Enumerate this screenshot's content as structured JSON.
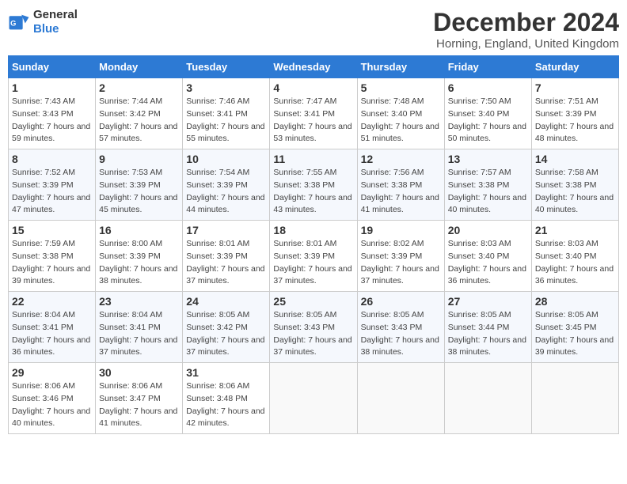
{
  "header": {
    "logo_line1": "General",
    "logo_line2": "Blue",
    "month": "December 2024",
    "location": "Horning, England, United Kingdom"
  },
  "weekdays": [
    "Sunday",
    "Monday",
    "Tuesday",
    "Wednesday",
    "Thursday",
    "Friday",
    "Saturday"
  ],
  "weeks": [
    [
      {
        "day": "1",
        "sunrise": "7:43 AM",
        "sunset": "3:43 PM",
        "daylight": "7 hours and 59 minutes."
      },
      {
        "day": "2",
        "sunrise": "7:44 AM",
        "sunset": "3:42 PM",
        "daylight": "7 hours and 57 minutes."
      },
      {
        "day": "3",
        "sunrise": "7:46 AM",
        "sunset": "3:41 PM",
        "daylight": "7 hours and 55 minutes."
      },
      {
        "day": "4",
        "sunrise": "7:47 AM",
        "sunset": "3:41 PM",
        "daylight": "7 hours and 53 minutes."
      },
      {
        "day": "5",
        "sunrise": "7:48 AM",
        "sunset": "3:40 PM",
        "daylight": "7 hours and 51 minutes."
      },
      {
        "day": "6",
        "sunrise": "7:50 AM",
        "sunset": "3:40 PM",
        "daylight": "7 hours and 50 minutes."
      },
      {
        "day": "7",
        "sunrise": "7:51 AM",
        "sunset": "3:39 PM",
        "daylight": "7 hours and 48 minutes."
      }
    ],
    [
      {
        "day": "8",
        "sunrise": "7:52 AM",
        "sunset": "3:39 PM",
        "daylight": "7 hours and 47 minutes."
      },
      {
        "day": "9",
        "sunrise": "7:53 AM",
        "sunset": "3:39 PM",
        "daylight": "7 hours and 45 minutes."
      },
      {
        "day": "10",
        "sunrise": "7:54 AM",
        "sunset": "3:39 PM",
        "daylight": "7 hours and 44 minutes."
      },
      {
        "day": "11",
        "sunrise": "7:55 AM",
        "sunset": "3:38 PM",
        "daylight": "7 hours and 43 minutes."
      },
      {
        "day": "12",
        "sunrise": "7:56 AM",
        "sunset": "3:38 PM",
        "daylight": "7 hours and 41 minutes."
      },
      {
        "day": "13",
        "sunrise": "7:57 AM",
        "sunset": "3:38 PM",
        "daylight": "7 hours and 40 minutes."
      },
      {
        "day": "14",
        "sunrise": "7:58 AM",
        "sunset": "3:38 PM",
        "daylight": "7 hours and 40 minutes."
      }
    ],
    [
      {
        "day": "15",
        "sunrise": "7:59 AM",
        "sunset": "3:38 PM",
        "daylight": "7 hours and 39 minutes."
      },
      {
        "day": "16",
        "sunrise": "8:00 AM",
        "sunset": "3:39 PM",
        "daylight": "7 hours and 38 minutes."
      },
      {
        "day": "17",
        "sunrise": "8:01 AM",
        "sunset": "3:39 PM",
        "daylight": "7 hours and 37 minutes."
      },
      {
        "day": "18",
        "sunrise": "8:01 AM",
        "sunset": "3:39 PM",
        "daylight": "7 hours and 37 minutes."
      },
      {
        "day": "19",
        "sunrise": "8:02 AM",
        "sunset": "3:39 PM",
        "daylight": "7 hours and 37 minutes."
      },
      {
        "day": "20",
        "sunrise": "8:03 AM",
        "sunset": "3:40 PM",
        "daylight": "7 hours and 36 minutes."
      },
      {
        "day": "21",
        "sunrise": "8:03 AM",
        "sunset": "3:40 PM",
        "daylight": "7 hours and 36 minutes."
      }
    ],
    [
      {
        "day": "22",
        "sunrise": "8:04 AM",
        "sunset": "3:41 PM",
        "daylight": "7 hours and 36 minutes."
      },
      {
        "day": "23",
        "sunrise": "8:04 AM",
        "sunset": "3:41 PM",
        "daylight": "7 hours and 37 minutes."
      },
      {
        "day": "24",
        "sunrise": "8:05 AM",
        "sunset": "3:42 PM",
        "daylight": "7 hours and 37 minutes."
      },
      {
        "day": "25",
        "sunrise": "8:05 AM",
        "sunset": "3:43 PM",
        "daylight": "7 hours and 37 minutes."
      },
      {
        "day": "26",
        "sunrise": "8:05 AM",
        "sunset": "3:43 PM",
        "daylight": "7 hours and 38 minutes."
      },
      {
        "day": "27",
        "sunrise": "8:05 AM",
        "sunset": "3:44 PM",
        "daylight": "7 hours and 38 minutes."
      },
      {
        "day": "28",
        "sunrise": "8:05 AM",
        "sunset": "3:45 PM",
        "daylight": "7 hours and 39 minutes."
      }
    ],
    [
      {
        "day": "29",
        "sunrise": "8:06 AM",
        "sunset": "3:46 PM",
        "daylight": "7 hours and 40 minutes."
      },
      {
        "day": "30",
        "sunrise": "8:06 AM",
        "sunset": "3:47 PM",
        "daylight": "7 hours and 41 minutes."
      },
      {
        "day": "31",
        "sunrise": "8:06 AM",
        "sunset": "3:48 PM",
        "daylight": "7 hours and 42 minutes."
      },
      null,
      null,
      null,
      null
    ]
  ]
}
